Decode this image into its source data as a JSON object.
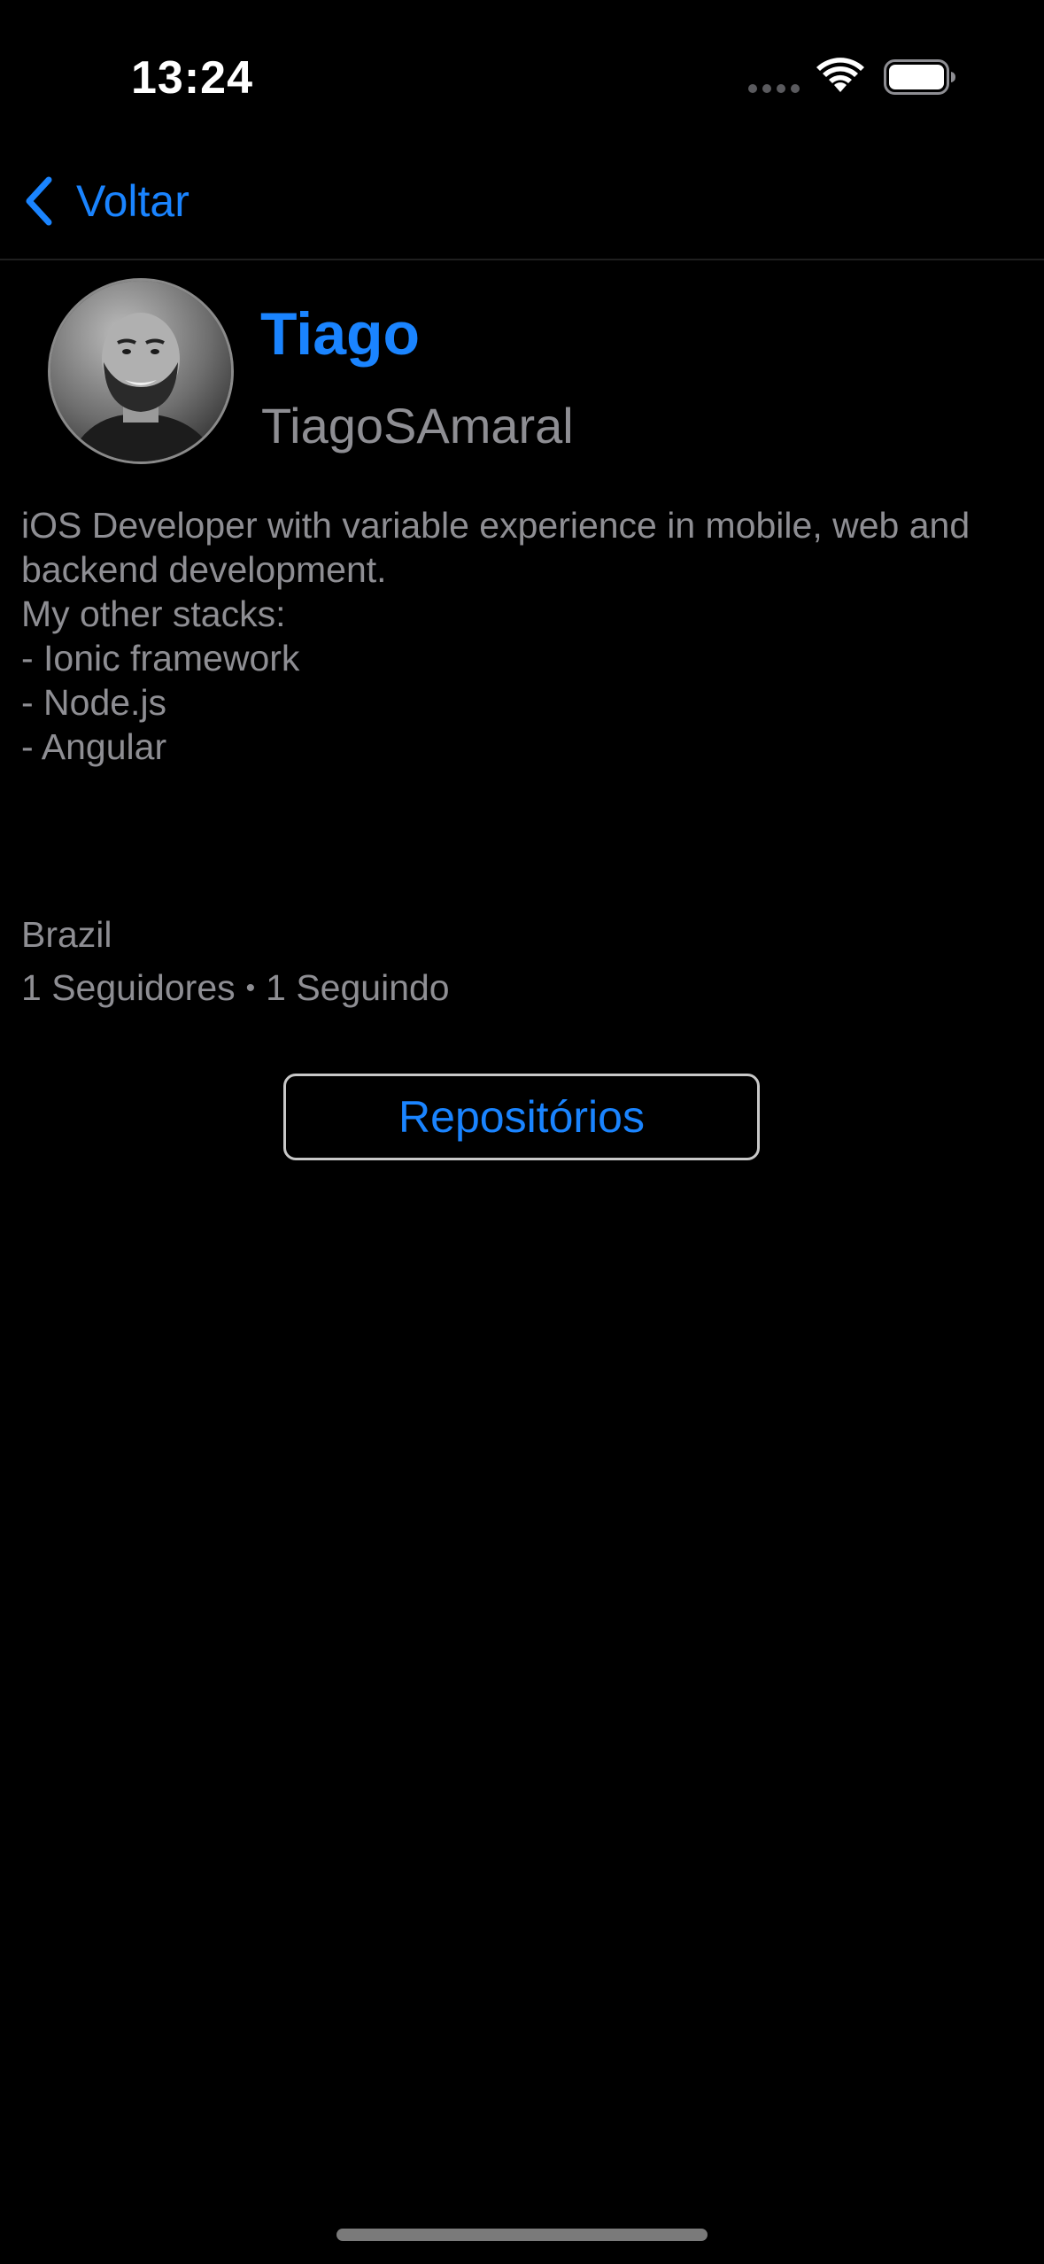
{
  "status_bar": {
    "time": "13:24",
    "icons": [
      "signal-dots-icon",
      "wifi-icon",
      "battery-icon"
    ]
  },
  "nav": {
    "back_label": "Voltar",
    "back_icon": "chevron-left-icon"
  },
  "profile": {
    "display_name": "Tiago",
    "login": "TiagoSAmaral",
    "bio_lines": [
      "iOS Developer with variable experience in mobile, web and",
      "backend development.",
      "My other stacks:",
      "- Ionic framework",
      "- Node.js",
      "- Angular"
    ],
    "location": "Brazil",
    "followers": "1 Seguidores",
    "separator": "•",
    "following": "1 Seguindo"
  },
  "actions": {
    "repositories_label": "Repositórios"
  },
  "colors": {
    "accent": "#1a84ff",
    "secondary_text": "#8e8e93",
    "background": "#000000"
  }
}
